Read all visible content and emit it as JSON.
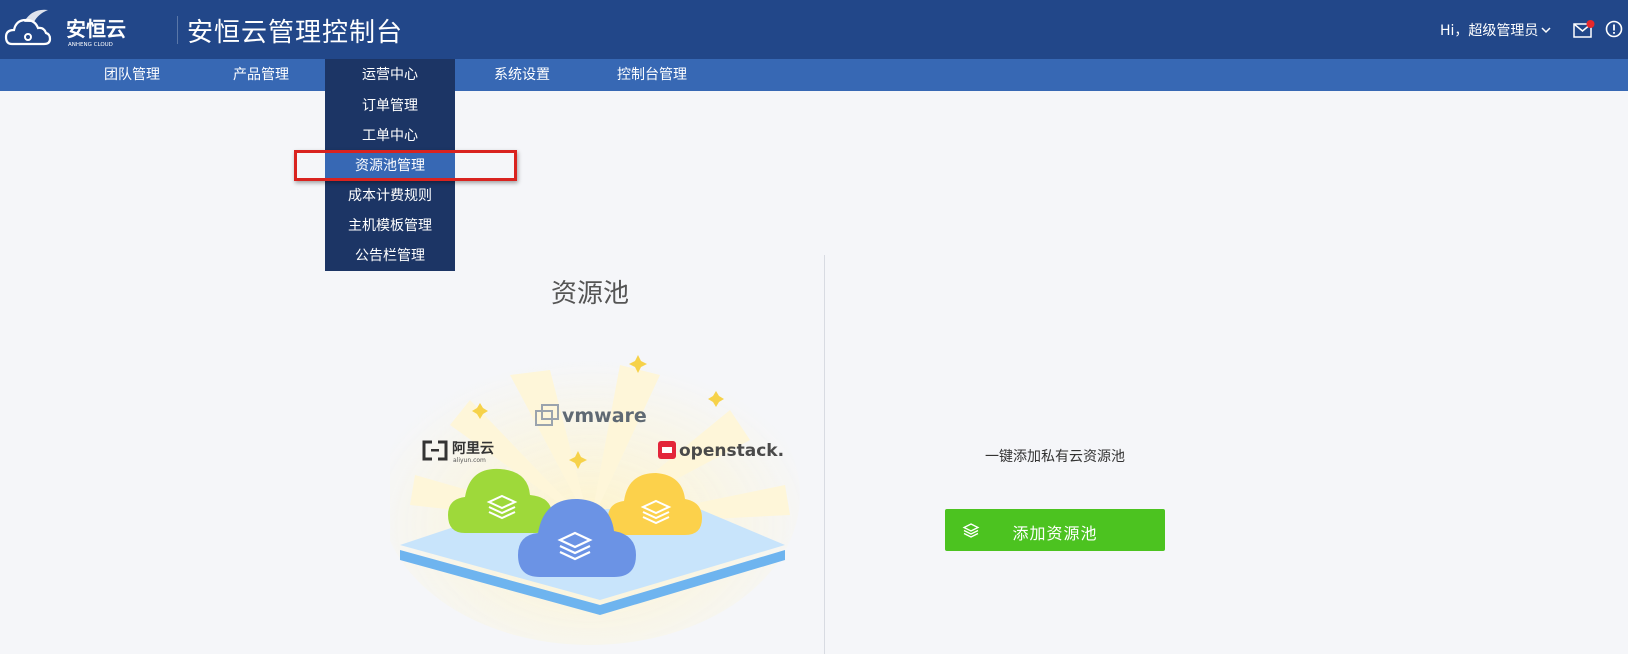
{
  "header": {
    "logo_text": "安恒云",
    "logo_subtext": "ANHENG CLOUD",
    "title": "安恒云管理控制台",
    "user_greeting": "Hi，超级管理员",
    "colors": {
      "header_bg": "#224789",
      "nav_bg": "#3768b4",
      "active_bg": "#1c3565"
    }
  },
  "nav": {
    "items": [
      {
        "label": "团队管理"
      },
      {
        "label": "产品管理"
      },
      {
        "label": "运营中心"
      },
      {
        "label": "系统设置"
      },
      {
        "label": "控制台管理"
      }
    ],
    "active": "运营中心"
  },
  "dropdown": {
    "items": [
      {
        "label": "订单管理"
      },
      {
        "label": "工单中心"
      },
      {
        "label": "资源池管理"
      },
      {
        "label": "成本计费规则"
      },
      {
        "label": "主机模板管理"
      },
      {
        "label": "公告栏管理"
      }
    ],
    "highlighted": "资源池管理"
  },
  "main": {
    "title": "资源池",
    "brands": {
      "vmware": "vmware",
      "aliyun": "阿里云",
      "aliyun_domain": "aliyun.com",
      "openstack": "openstack."
    },
    "tagline": "一键添加私有云资源池",
    "add_button_label": "添加资源池",
    "accent_color": "#4cc320"
  }
}
